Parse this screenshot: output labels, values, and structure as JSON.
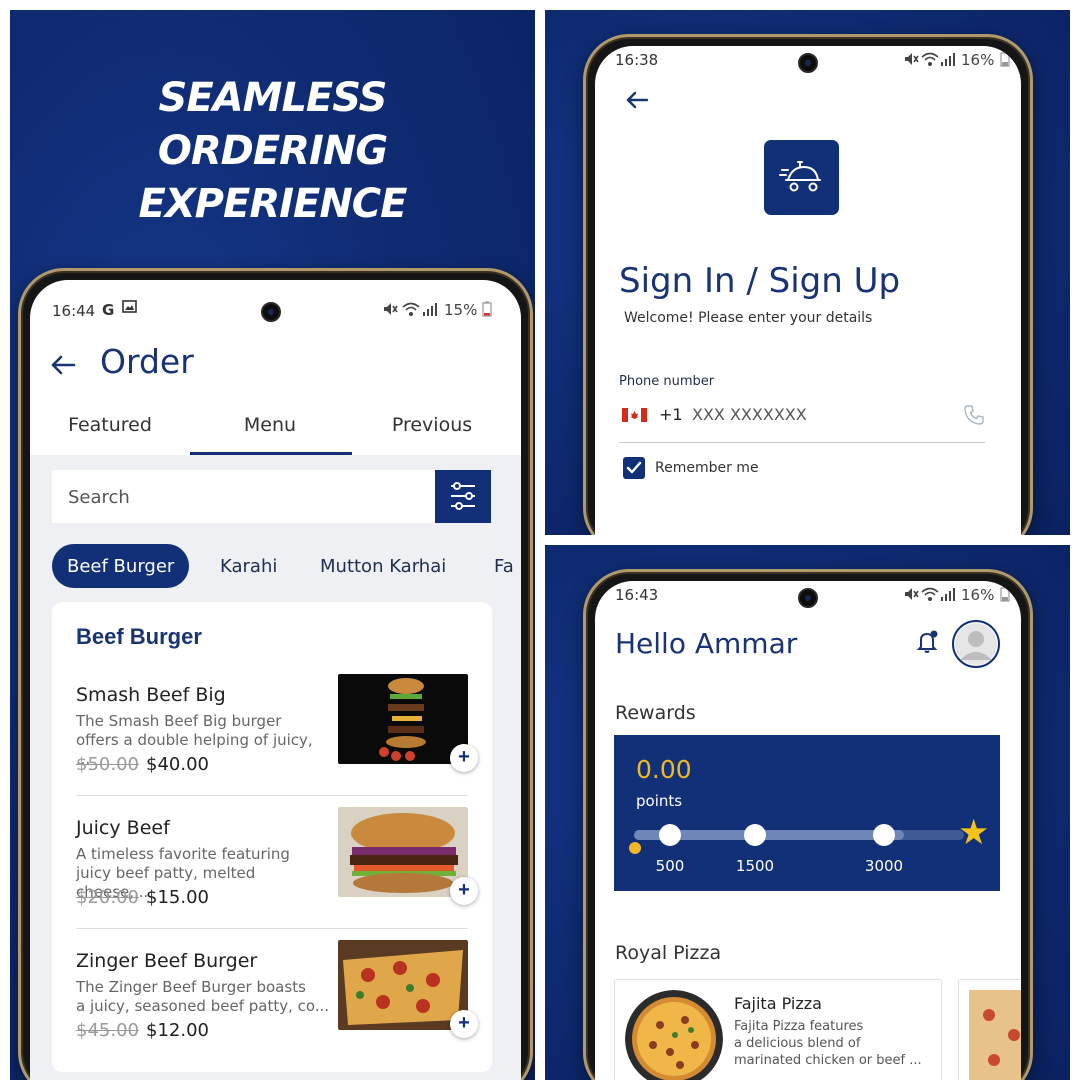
{
  "promo": {
    "headline": [
      "SEAMLESS",
      "ORDERING",
      "EXPERIENCE"
    ]
  },
  "order_screen": {
    "status": {
      "time": "16:44",
      "battery": "15%"
    },
    "title": "Order",
    "tabs": [
      {
        "label": "Featured",
        "active": false
      },
      {
        "label": "Menu",
        "active": true
      },
      {
        "label": "Previous",
        "active": false
      }
    ],
    "search_placeholder": "Search",
    "categories": [
      {
        "label": "Beef Burger",
        "active": true
      },
      {
        "label": "Karahi",
        "active": false
      },
      {
        "label": "Mutton Karhai",
        "active": false
      },
      {
        "label": "Fa",
        "active": false
      }
    ],
    "section_title": "Beef Burger",
    "items": [
      {
        "name": "Smash Beef Big",
        "desc_line1": "The Smash Beef Big burger",
        "desc_line2": "offers a double helping of juicy, ...",
        "old_price": "$50.00",
        "price": "$40.00"
      },
      {
        "name": "Juicy Beef",
        "desc_line1": "A timeless favorite featuring",
        "desc_line2": "juicy beef patty, melted cheese,...",
        "old_price": "$20.00",
        "price": "$15.00"
      },
      {
        "name": "Zinger Beef Burger",
        "desc_line1": "The Zinger Beef Burger boasts",
        "desc_line2": "a juicy, seasoned beef patty, co...",
        "old_price": "$45.00",
        "price": "$12.00"
      }
    ],
    "add_symbol": "+"
  },
  "signin_screen": {
    "status": {
      "time": "16:38",
      "battery": "16%"
    },
    "title": "Sign In / Sign Up",
    "subtitle": "Welcome! Please enter your details",
    "phone_label": "Phone number",
    "country_code": "+1",
    "phone_placeholder": "XXX XXXXXXX",
    "remember_label": "Remember me",
    "remember_checked": true
  },
  "home_screen": {
    "status": {
      "time": "16:43",
      "battery": "16%"
    },
    "greeting": "Hello Ammar",
    "rewards_title": "Rewards",
    "points_value": "0.00",
    "points_label": "points",
    "milestones": [
      "500",
      "1500",
      "3000"
    ],
    "section_title": "Royal Pizza",
    "pizza": {
      "name": "Fajita Pizza",
      "desc_line1": "Fajita Pizza features",
      "desc_line2": "a delicious blend of",
      "desc_line3": "marinated chicken or beef ..."
    }
  },
  "colors": {
    "brand_blue": "#123077",
    "accent_gold": "#f2b823",
    "panel_blue": "#0f2c74"
  }
}
